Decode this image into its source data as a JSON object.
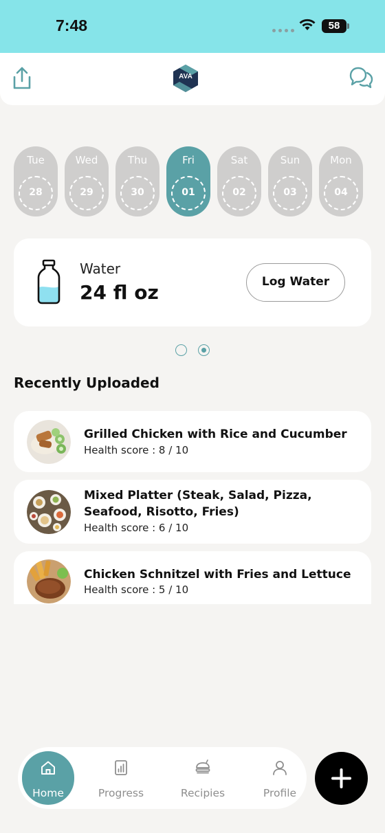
{
  "status_bar": {
    "time": "7:48",
    "battery": "58"
  },
  "header": {
    "logo_text": "AVA"
  },
  "days": [
    {
      "name": "Tue",
      "date": "28",
      "active": false
    },
    {
      "name": "Wed",
      "date": "29",
      "active": false
    },
    {
      "name": "Thu",
      "date": "30",
      "active": false
    },
    {
      "name": "Fri",
      "date": "01",
      "active": true
    },
    {
      "name": "Sat",
      "date": "02",
      "active": false
    },
    {
      "name": "Sun",
      "date": "03",
      "active": false
    },
    {
      "name": "Mon",
      "date": "04",
      "active": false
    }
  ],
  "water": {
    "label": "Water",
    "value": "24 fl oz",
    "button": "Log Water"
  },
  "pager": {
    "count": 2,
    "active_index": 1
  },
  "recent": {
    "title": "Recently Uploaded",
    "items": [
      {
        "name": "Grilled Chicken with Rice and Cucumber",
        "score": "Health score : 8 / 10"
      },
      {
        "name": "Mixed Platter (Steak, Salad, Pizza, Seafood, Risotto, Fries)",
        "score": "Health score : 6 / 10"
      },
      {
        "name": "Chicken Schnitzel with Fries and Lettuce",
        "score": "Health score : 5 / 10"
      }
    ]
  },
  "nav": {
    "items": [
      {
        "label": "Home",
        "icon": "home-icon",
        "active": true
      },
      {
        "label": "Progress",
        "icon": "chart-icon",
        "active": false
      },
      {
        "label": "Recipies",
        "icon": "recipe-icon",
        "active": false
      },
      {
        "label": "Profile",
        "icon": "user-icon",
        "active": false
      }
    ],
    "fab_icon": "plus-icon"
  },
  "colors": {
    "status_bar": "#86e4e9",
    "accent": "#5aa1a6",
    "background": "#f5f4f2",
    "inactive_day": "#cfcecd",
    "water_fill": "#8fe0f0"
  }
}
